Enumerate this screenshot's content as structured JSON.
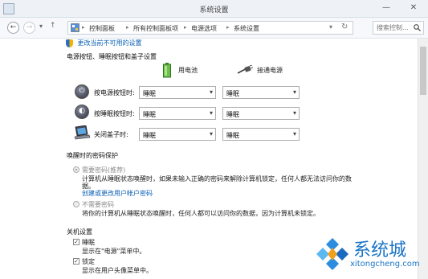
{
  "window": {
    "title": "系统设置",
    "minimize": "—",
    "close": "✕"
  },
  "address": {
    "back": "←",
    "forward": "→",
    "recent": "▾",
    "up": "↑",
    "breadcrumb": [
      "控制面板",
      "所有控制面板项",
      "电源选项",
      "系统设置"
    ],
    "separator": "▸",
    "dropdown": "▾",
    "refresh": "↻",
    "search_placeholder": "搜索控制...",
    "search_icon": "magnifier-icon"
  },
  "change_unavailable_link": "更改当前不可用的设置",
  "power_section": {
    "title": "电源按钮、睡眠按钮和盖子设置",
    "col_battery": "用电池",
    "col_plugged": "接通电源",
    "rows": [
      {
        "label": "按电源按钮时:",
        "icon": "power-button-icon",
        "battery": "睡眠",
        "plugged": "睡眠"
      },
      {
        "label": "按睡眠按钮时:",
        "icon": "sleep-button-icon",
        "battery": "睡眠",
        "plugged": "睡眠"
      },
      {
        "label": "关闭盖子时:",
        "icon": "laptop-lid-icon",
        "battery": "睡眠",
        "plugged": "睡眠"
      }
    ]
  },
  "wake_section": {
    "title": "唤醒时的密码保护",
    "require_option": "需要密码(推荐)",
    "require_desc": "计算机从睡眠状态唤醒时，如果未输入正确的密码来解除计算机锁定，任何人都无法访问你的数",
    "require_desc2": "据。",
    "account_link": "创建或更改用户帐户密码",
    "norequire_option": "不需要密码",
    "norequire_desc": "将你的计算机从睡眠状态唤醒时，任何人都可以访问你的数据，因为计算机未锁定。"
  },
  "shutdown_section": {
    "title": "关机设置",
    "items": [
      {
        "label": "睡眠",
        "desc": "显示在\"电源\"菜单中。",
        "checked": true
      },
      {
        "label": "锁定",
        "desc": "显示在用户头像菜单中。",
        "checked": true
      }
    ]
  },
  "watermark": {
    "name": "系统城",
    "url": "xitongcheng.com"
  },
  "colors": {
    "link": "#0a5fb5",
    "watermark": "#1a74c7"
  }
}
